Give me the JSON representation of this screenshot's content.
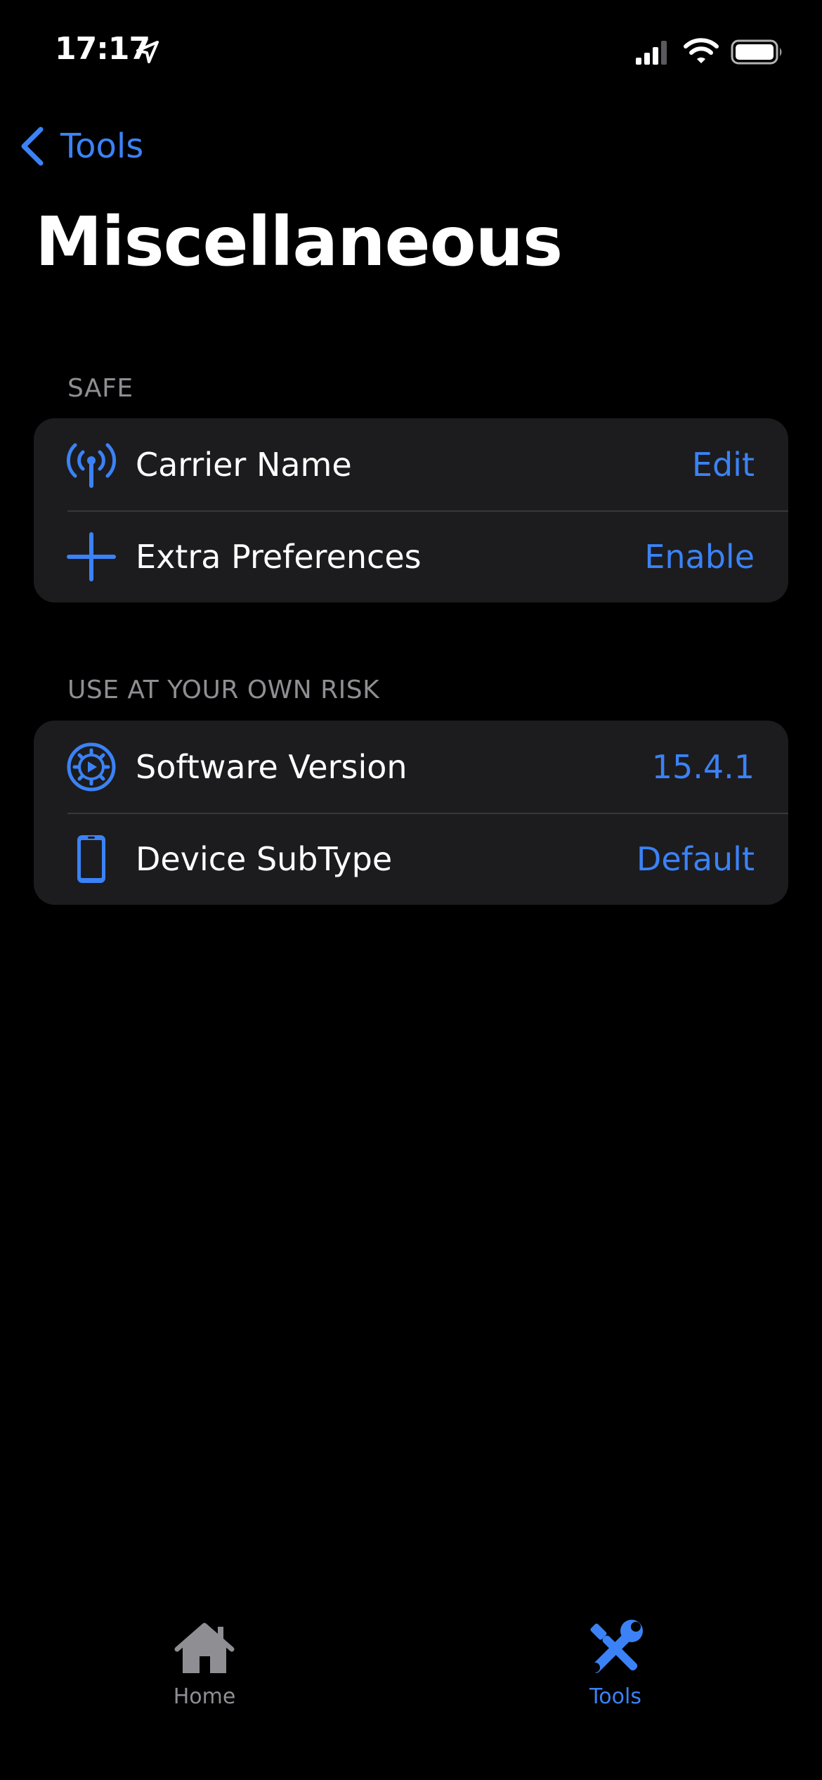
{
  "status_bar": {
    "time": "17:17"
  },
  "nav": {
    "back_label": "Tools"
  },
  "page": {
    "title": "Miscellaneous"
  },
  "sections": [
    {
      "header": "SAFE",
      "rows": [
        {
          "label": "Carrier Name",
          "value": "Edit",
          "icon": "antenna-icon"
        },
        {
          "label": "Extra Preferences",
          "value": "Enable",
          "icon": "plus-icon"
        }
      ]
    },
    {
      "header": "USE AT YOUR OWN RISK",
      "rows": [
        {
          "label": "Software Version",
          "value": "15.4.1",
          "icon": "gear-badge-icon"
        },
        {
          "label": "Device SubType",
          "value": "Default",
          "icon": "iphone-icon"
        }
      ]
    }
  ],
  "tab_bar": {
    "tabs": [
      {
        "label": "Home",
        "icon": "house-icon",
        "selected": false
      },
      {
        "label": "Tools",
        "icon": "wrench-screwdriver-icon",
        "selected": true
      }
    ]
  },
  "colors": {
    "accent": "#3b82f6",
    "background": "#000000",
    "group_background": "#1c1c1e",
    "secondary_text": "#8e8e93"
  }
}
